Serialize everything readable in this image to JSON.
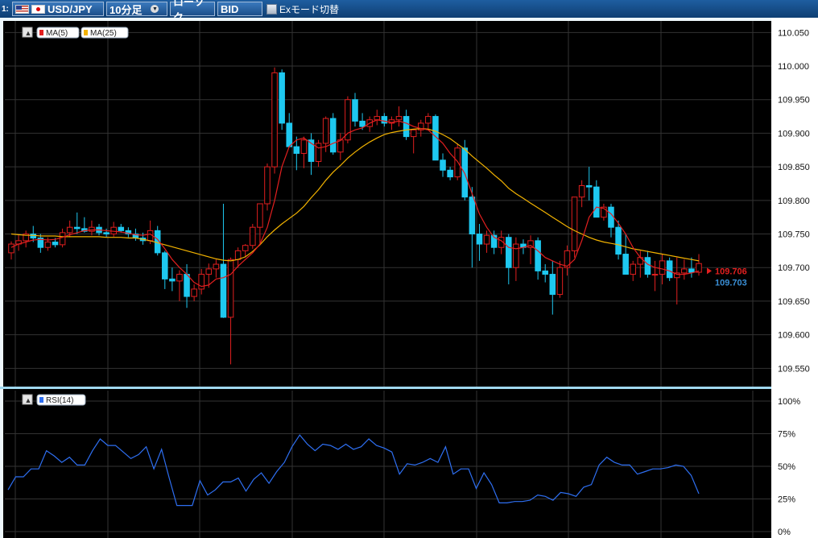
{
  "toolbar": {
    "index": "1:",
    "pair": "USD/JPY",
    "timeframe": "10分足",
    "chart_type": "ローソク",
    "price_side": "BID",
    "ex_mode_label": "Exモード切替"
  },
  "colors": {
    "bull_body": "#000000",
    "bull_border": "#e01f1f",
    "bear_body": "#1ec8f0",
    "ma5": "#e21f1f",
    "ma25": "#f3b300",
    "rsi": "#2e6ff2",
    "grid": "#333333",
    "axis_bg": "#ffffff",
    "separator": "#9fd8ef"
  },
  "legend": {
    "ma5": "MA(5)",
    "ma25": "MA(25)",
    "rsi": "RSI(14)"
  },
  "badges": {
    "ma5_value": "109.706",
    "ma25_value": "109.703"
  },
  "chart_data": [
    {
      "type": "candlestick",
      "title": "",
      "ylim": [
        109.53,
        110.06
      ],
      "yticks": [
        "110.050",
        "110.000",
        "109.950",
        "109.900",
        "109.850",
        "109.800",
        "109.750",
        "109.700",
        "109.650",
        "109.600",
        "109.550"
      ],
      "grid": true,
      "legend_position": "top-left",
      "ohlc": [
        [
          109.722,
          109.739,
          109.712,
          109.735
        ],
        [
          109.735,
          109.749,
          109.725,
          109.74
        ],
        [
          109.74,
          109.755,
          109.73,
          109.75
        ],
        [
          109.75,
          109.762,
          109.738,
          109.744
        ],
        [
          109.744,
          109.75,
          109.722,
          109.73
        ],
        [
          109.73,
          109.745,
          109.725,
          109.738
        ],
        [
          109.738,
          109.744,
          109.73,
          109.734
        ],
        [
          109.734,
          109.758,
          109.73,
          109.752
        ],
        [
          109.752,
          109.77,
          109.745,
          109.76
        ],
        [
          109.76,
          109.782,
          109.75,
          109.758
        ],
        [
          109.758,
          109.775,
          109.752,
          109.754
        ],
        [
          109.754,
          109.77,
          109.748,
          109.76
        ],
        [
          109.76,
          109.765,
          109.748,
          109.752
        ],
        [
          109.752,
          109.758,
          109.745,
          109.75
        ],
        [
          109.75,
          109.768,
          109.746,
          109.76
        ],
        [
          109.76,
          109.765,
          109.752,
          109.755
        ],
        [
          109.755,
          109.76,
          109.745,
          109.75
        ],
        [
          109.75,
          109.758,
          109.74,
          109.744
        ],
        [
          109.744,
          109.752,
          109.734,
          109.74
        ],
        [
          109.74,
          109.77,
          109.735,
          109.755
        ],
        [
          109.755,
          109.762,
          109.718,
          109.722
        ],
        [
          109.722,
          109.725,
          109.668,
          109.683
        ],
        [
          109.683,
          109.7,
          109.665,
          109.68
        ],
        [
          109.68,
          109.696,
          109.65,
          109.69
        ],
        [
          109.69,
          109.705,
          109.64,
          109.657
        ],
        [
          109.657,
          109.675,
          109.65,
          109.668
        ],
        [
          109.668,
          109.698,
          109.66,
          109.69
        ],
        [
          109.69,
          109.706,
          109.67,
          109.698
        ],
        [
          109.698,
          109.712,
          109.685,
          109.705
        ],
        [
          109.705,
          109.795,
          109.625,
          109.626
        ],
        [
          109.626,
          109.715,
          109.556,
          109.712
        ],
        [
          109.712,
          109.73,
          109.7,
          109.725
        ],
        [
          109.725,
          109.735,
          109.715,
          109.733
        ],
        [
          109.733,
          109.765,
          109.728,
          109.76
        ],
        [
          109.76,
          109.783,
          109.735,
          109.795
        ],
        [
          109.795,
          109.855,
          109.785,
          109.85
        ],
        [
          109.85,
          109.998,
          109.84,
          109.99
        ],
        [
          109.99,
          109.995,
          109.905,
          109.915
        ],
        [
          109.915,
          109.93,
          109.88,
          109.88
        ],
        [
          109.88,
          109.895,
          109.845,
          109.87
        ],
        [
          109.87,
          109.895,
          109.848,
          109.89
        ],
        [
          109.89,
          109.9,
          109.838,
          109.858
        ],
        [
          109.858,
          109.89,
          109.85,
          109.885
        ],
        [
          109.885,
          109.925,
          109.872,
          109.922
        ],
        [
          109.922,
          109.93,
          109.868,
          109.872
        ],
        [
          109.872,
          109.9,
          109.86,
          109.89
        ],
        [
          109.89,
          109.955,
          109.885,
          109.95
        ],
        [
          109.95,
          109.96,
          109.91,
          109.918
        ],
        [
          109.918,
          109.93,
          109.905,
          109.91
        ],
        [
          109.91,
          109.925,
          109.902,
          109.92
        ],
        [
          109.92,
          109.935,
          109.912,
          109.925
        ],
        [
          109.925,
          109.93,
          109.91,
          109.915
        ],
        [
          109.915,
          109.925,
          109.905,
          109.92
        ],
        [
          109.92,
          109.94,
          109.91,
          109.925
        ],
        [
          109.925,
          109.935,
          109.89,
          109.895
        ],
        [
          109.895,
          109.905,
          109.87,
          109.905
        ],
        [
          109.905,
          109.92,
          109.895,
          109.915
        ],
        [
          109.915,
          109.93,
          109.905,
          109.925
        ],
        [
          109.925,
          109.928,
          109.86,
          109.86
        ],
        [
          109.86,
          109.87,
          109.835,
          109.845
        ],
        [
          109.845,
          109.85,
          109.83,
          109.835
        ],
        [
          109.835,
          109.885,
          109.83,
          109.878
        ],
        [
          109.878,
          109.89,
          109.8,
          109.805
        ],
        [
          109.805,
          109.82,
          109.7,
          109.75
        ],
        [
          109.75,
          109.765,
          109.71,
          109.735
        ],
        [
          109.735,
          109.755,
          109.722,
          109.748
        ],
        [
          109.748,
          109.755,
          109.72,
          109.73
        ],
        [
          109.73,
          109.755,
          109.72,
          109.745
        ],
        [
          109.745,
          109.75,
          109.675,
          109.7
        ],
        [
          109.7,
          109.745,
          109.68,
          109.735
        ],
        [
          109.735,
          109.742,
          109.72,
          109.73
        ],
        [
          109.73,
          109.748,
          109.705,
          109.74
        ],
        [
          109.74,
          109.745,
          109.682,
          109.695
        ],
        [
          109.695,
          109.705,
          109.678,
          109.69
        ],
        [
          109.69,
          109.71,
          109.63,
          109.66
        ],
        [
          109.66,
          109.71,
          109.655,
          109.7
        ],
        [
          109.7,
          109.733,
          109.688,
          109.725
        ],
        [
          109.725,
          109.805,
          109.715,
          109.805
        ],
        [
          109.805,
          109.83,
          109.79,
          109.822
        ],
        [
          109.822,
          109.85,
          109.8,
          109.82
        ],
        [
          109.82,
          109.83,
          109.78,
          109.775
        ],
        [
          109.775,
          109.795,
          109.77,
          109.79
        ],
        [
          109.79,
          109.795,
          109.745,
          109.76
        ],
        [
          109.76,
          109.77,
          109.712,
          109.72
        ],
        [
          109.72,
          109.75,
          109.7,
          109.69
        ],
        [
          109.69,
          109.71,
          109.68,
          109.705
        ],
        [
          109.705,
          109.725,
          109.685,
          109.715
        ],
        [
          109.715,
          109.725,
          109.685,
          109.69
        ],
        [
          109.69,
          109.71,
          109.665,
          109.69
        ],
        [
          109.69,
          109.72,
          109.675,
          109.71
        ],
        [
          109.71,
          109.715,
          109.68,
          109.685
        ],
        [
          109.685,
          109.715,
          109.645,
          109.692
        ],
        [
          109.692,
          109.712,
          109.682,
          109.698
        ],
        [
          109.698,
          109.715,
          109.685,
          109.693
        ],
        [
          109.693,
          109.72,
          109.688,
          109.706
        ]
      ],
      "ma5": [
        109.73,
        109.735,
        109.738,
        109.741,
        109.742,
        109.741,
        109.742,
        109.745,
        109.749,
        109.752,
        109.755,
        109.756,
        109.756,
        109.755,
        109.754,
        109.753,
        109.751,
        109.749,
        109.748,
        109.75,
        109.742,
        109.728,
        109.712,
        109.7,
        109.69,
        109.678,
        109.672,
        109.674,
        109.683,
        109.685,
        109.69,
        109.702,
        109.712,
        109.722,
        109.735,
        109.76,
        109.8,
        109.85,
        109.88,
        109.89,
        109.893,
        109.885,
        109.878,
        109.88,
        109.885,
        109.889,
        109.9,
        109.905,
        109.908,
        109.915,
        109.92,
        109.918,
        109.916,
        109.918,
        109.915,
        109.91,
        109.907,
        109.905,
        109.895,
        109.885,
        109.87,
        109.858,
        109.84,
        109.81,
        109.78,
        109.76,
        109.745,
        109.74,
        109.73,
        109.728,
        109.73,
        109.733,
        109.725,
        109.715,
        109.71,
        109.705,
        109.702,
        109.712,
        109.74,
        109.775,
        109.79,
        109.788,
        109.78,
        109.766,
        109.75,
        109.73,
        109.715,
        109.705,
        109.7,
        109.698,
        109.695,
        109.69,
        109.69,
        109.692,
        109.695
      ],
      "ma25": [
        109.75,
        109.749,
        109.748,
        109.748,
        109.747,
        109.747,
        109.747,
        109.746,
        109.746,
        109.746,
        109.746,
        109.746,
        109.746,
        109.745,
        109.745,
        109.745,
        109.744,
        109.744,
        109.742,
        109.74,
        109.737,
        109.734,
        109.731,
        109.728,
        109.725,
        109.722,
        109.719,
        109.716,
        109.713,
        109.711,
        109.71,
        109.712,
        109.716,
        109.724,
        109.734,
        109.746,
        109.756,
        109.765,
        109.773,
        109.781,
        109.791,
        109.804,
        109.816,
        109.83,
        109.842,
        109.852,
        109.863,
        109.872,
        109.88,
        109.887,
        109.893,
        109.898,
        109.901,
        109.903,
        109.905,
        109.906,
        109.907,
        109.906,
        109.903,
        109.898,
        109.892,
        109.884,
        109.876,
        109.866,
        109.857,
        109.848,
        109.838,
        109.829,
        109.818,
        109.81,
        109.803,
        109.796,
        109.789,
        109.782,
        109.775,
        109.768,
        109.761,
        109.755,
        109.75,
        109.745,
        109.741,
        109.738,
        109.736,
        109.734,
        109.731,
        109.728,
        109.726,
        109.724,
        109.722,
        109.72,
        109.718,
        109.716,
        109.714,
        109.712,
        109.71
      ]
    },
    {
      "type": "line",
      "title": "",
      "ylim": [
        0,
        100
      ],
      "yticks": [
        "100%",
        "75%",
        "50%",
        "25%",
        "0%"
      ],
      "grid": true,
      "legend_position": "top-left",
      "series": [
        {
          "name": "RSI(14)",
          "values": [
            32,
            42,
            42,
            48,
            48,
            62,
            58,
            53,
            57,
            51,
            51,
            62,
            71,
            66,
            66,
            61,
            56,
            59,
            65,
            48,
            63,
            41,
            20,
            20,
            20,
            39,
            28,
            32,
            38,
            38,
            41,
            31,
            40,
            45,
            37,
            46,
            53,
            65,
            74,
            67,
            62,
            67,
            66,
            63,
            67,
            63,
            65,
            71,
            66,
            64,
            61,
            44,
            52,
            51,
            53,
            56,
            53,
            65,
            44,
            48,
            48,
            33,
            45,
            36,
            22,
            22,
            23,
            23,
            24,
            28,
            27,
            24,
            30,
            29,
            27,
            34,
            36,
            51,
            57,
            53,
            51,
            51,
            44,
            46,
            48,
            48,
            49,
            51,
            50,
            43,
            29
          ]
        }
      ]
    }
  ]
}
